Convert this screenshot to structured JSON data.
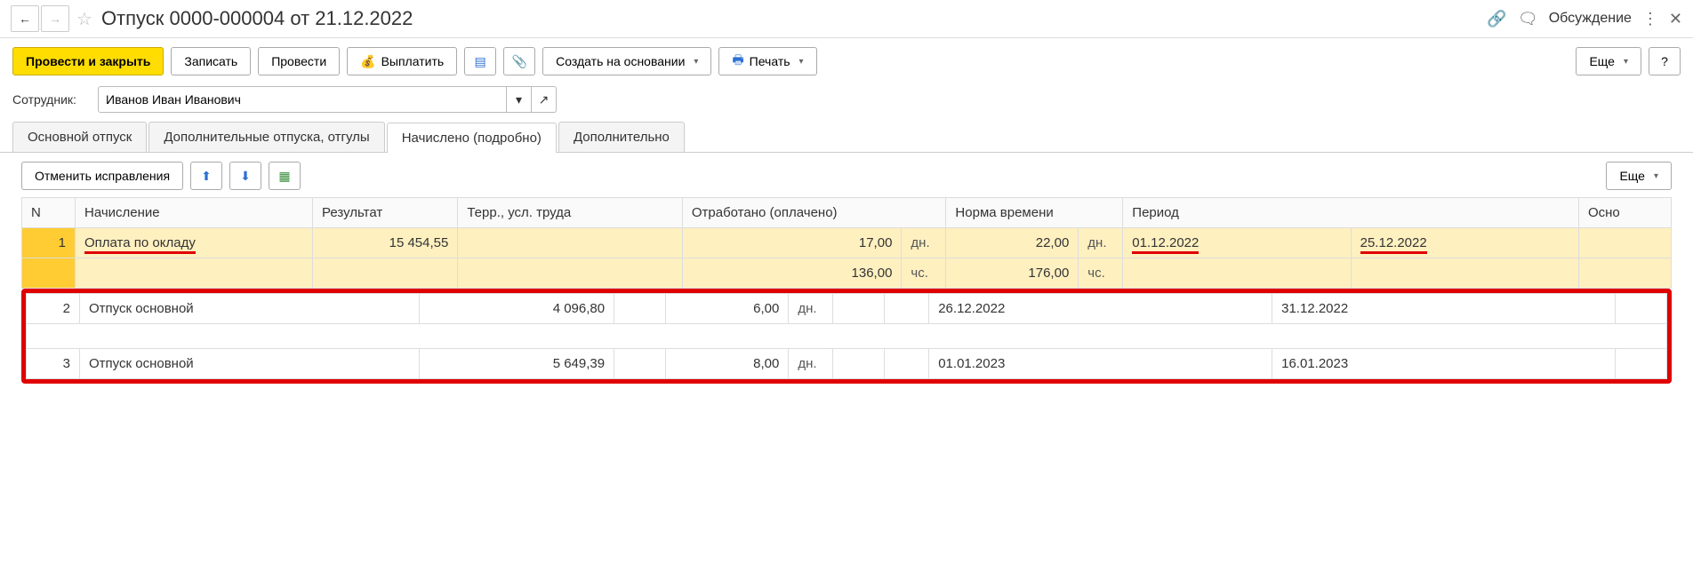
{
  "header": {
    "title": "Отпуск 0000-000004 от 21.12.2022",
    "back": "←",
    "forward": "→",
    "discuss": "Обсуждение"
  },
  "toolbar": {
    "post_close": "Провести и закрыть",
    "save": "Записать",
    "post": "Провести",
    "payout": "Выплатить",
    "create_based": "Создать на основании",
    "print": "Печать",
    "more": "Еще",
    "help": "?"
  },
  "form": {
    "employee_label": "Сотрудник:",
    "employee_value": "Иванов Иван Иванович"
  },
  "tabs": {
    "main": "Основной отпуск",
    "additional": "Дополнительные отпуска, отгулы",
    "calc_detail": "Начислено (подробно)",
    "extra": "Дополнительно"
  },
  "sub_toolbar": {
    "cancel_fix": "Отменить исправления",
    "more": "Еще"
  },
  "table": {
    "headers": {
      "n": "N",
      "accrual": "Начисление",
      "result": "Результат",
      "terr": "Терр., усл. труда",
      "worked": "Отработано (оплачено)",
      "norm": "Норма времени",
      "period": "Период",
      "osn": "Осно"
    },
    "units": {
      "days": "дн.",
      "hours": "чс."
    },
    "rows": [
      {
        "n": "1",
        "accrual": "Оплата по окладу",
        "result": "15 454,55",
        "worked_d": "17,00",
        "norm_d": "22,00",
        "worked_h": "136,00",
        "norm_h": "176,00",
        "p_start": "01.12.2022",
        "p_end": "25.12.2022"
      },
      {
        "n": "2",
        "accrual": "Отпуск основной",
        "result": "4 096,80",
        "worked_d": "6,00",
        "norm_d": "",
        "p_start": "26.12.2022",
        "p_end": "31.12.2022"
      },
      {
        "n": "3",
        "accrual": "Отпуск основной",
        "result": "5 649,39",
        "worked_d": "8,00",
        "norm_d": "",
        "p_start": "01.01.2023",
        "p_end": "16.01.2023"
      }
    ]
  }
}
